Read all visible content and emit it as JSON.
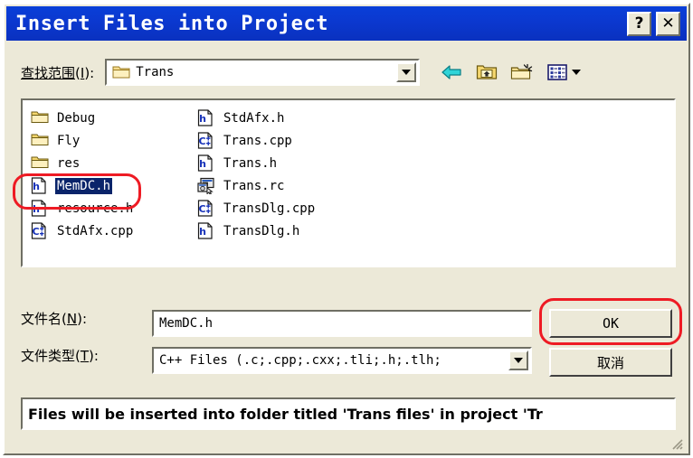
{
  "window": {
    "title": "Insert Files into Project",
    "help_button": "?",
    "close_button": "✕"
  },
  "lookin": {
    "label_prefix": "查找范围",
    "label_accel": "I",
    "label_suffix": "):",
    "value": "Trans",
    "dropdown_icon": "chevron-down-icon",
    "toolbar": [
      {
        "name": "back-icon",
        "tooltip": "Back"
      },
      {
        "name": "up-one-level-icon",
        "tooltip": "Up One Level"
      },
      {
        "name": "new-folder-icon",
        "tooltip": "Create New Folder"
      },
      {
        "name": "views-icon",
        "tooltip": "Views"
      }
    ]
  },
  "file_list": {
    "column_a": [
      {
        "label": "Debug",
        "icon": "folder-icon",
        "selected": false
      },
      {
        "label": "Fly",
        "icon": "folder-icon",
        "selected": false
      },
      {
        "label": "res",
        "icon": "folder-icon",
        "selected": false
      },
      {
        "label": "MemDC.h",
        "icon": "h-file-icon",
        "selected": true
      },
      {
        "label": "resource.h",
        "icon": "h-file-icon",
        "selected": false
      },
      {
        "label": "StdAfx.cpp",
        "icon": "cpp-file-icon",
        "selected": false
      }
    ],
    "column_b": [
      {
        "label": "StdAfx.h",
        "icon": "h-file-icon",
        "selected": false
      },
      {
        "label": "Trans.cpp",
        "icon": "cpp-file-icon",
        "selected": false
      },
      {
        "label": "Trans.h",
        "icon": "h-file-icon",
        "selected": false
      },
      {
        "label": "Trans.rc",
        "icon": "rc-file-icon",
        "selected": false
      },
      {
        "label": "TransDlg.cpp",
        "icon": "cpp-file-icon",
        "selected": false
      },
      {
        "label": "TransDlg.h",
        "icon": "h-file-icon",
        "selected": false
      }
    ]
  },
  "filename_row": {
    "label_prefix": "文件名(",
    "label_accel": "N",
    "label_suffix": "):",
    "value": "MemDC.h",
    "placeholder": ""
  },
  "filetype_row": {
    "label_prefix": "文件类型(",
    "label_accel": "T",
    "label_suffix": "):",
    "value": "C++ Files (.c;.cpp;.cxx;.tli;.h;.tlh;",
    "dropdown_icon": "chevron-down-icon"
  },
  "buttons": {
    "ok": "OK",
    "cancel": "取消"
  },
  "status": {
    "message": "Files will be inserted into folder titled 'Trans files' in project 'Tr"
  },
  "annotations": [
    {
      "name": "annotation-selected-file",
      "target": "MemDC.h",
      "color": "#ee1b24"
    },
    {
      "name": "annotation-ok-button",
      "target": "OK",
      "color": "#ee1b24"
    }
  ],
  "colors": {
    "titlebar": "#0a38d0",
    "dialog_face": "#ece9d8",
    "selection": "#0a246a",
    "annotation": "#ee1b24",
    "folder": "#f5d76e"
  }
}
